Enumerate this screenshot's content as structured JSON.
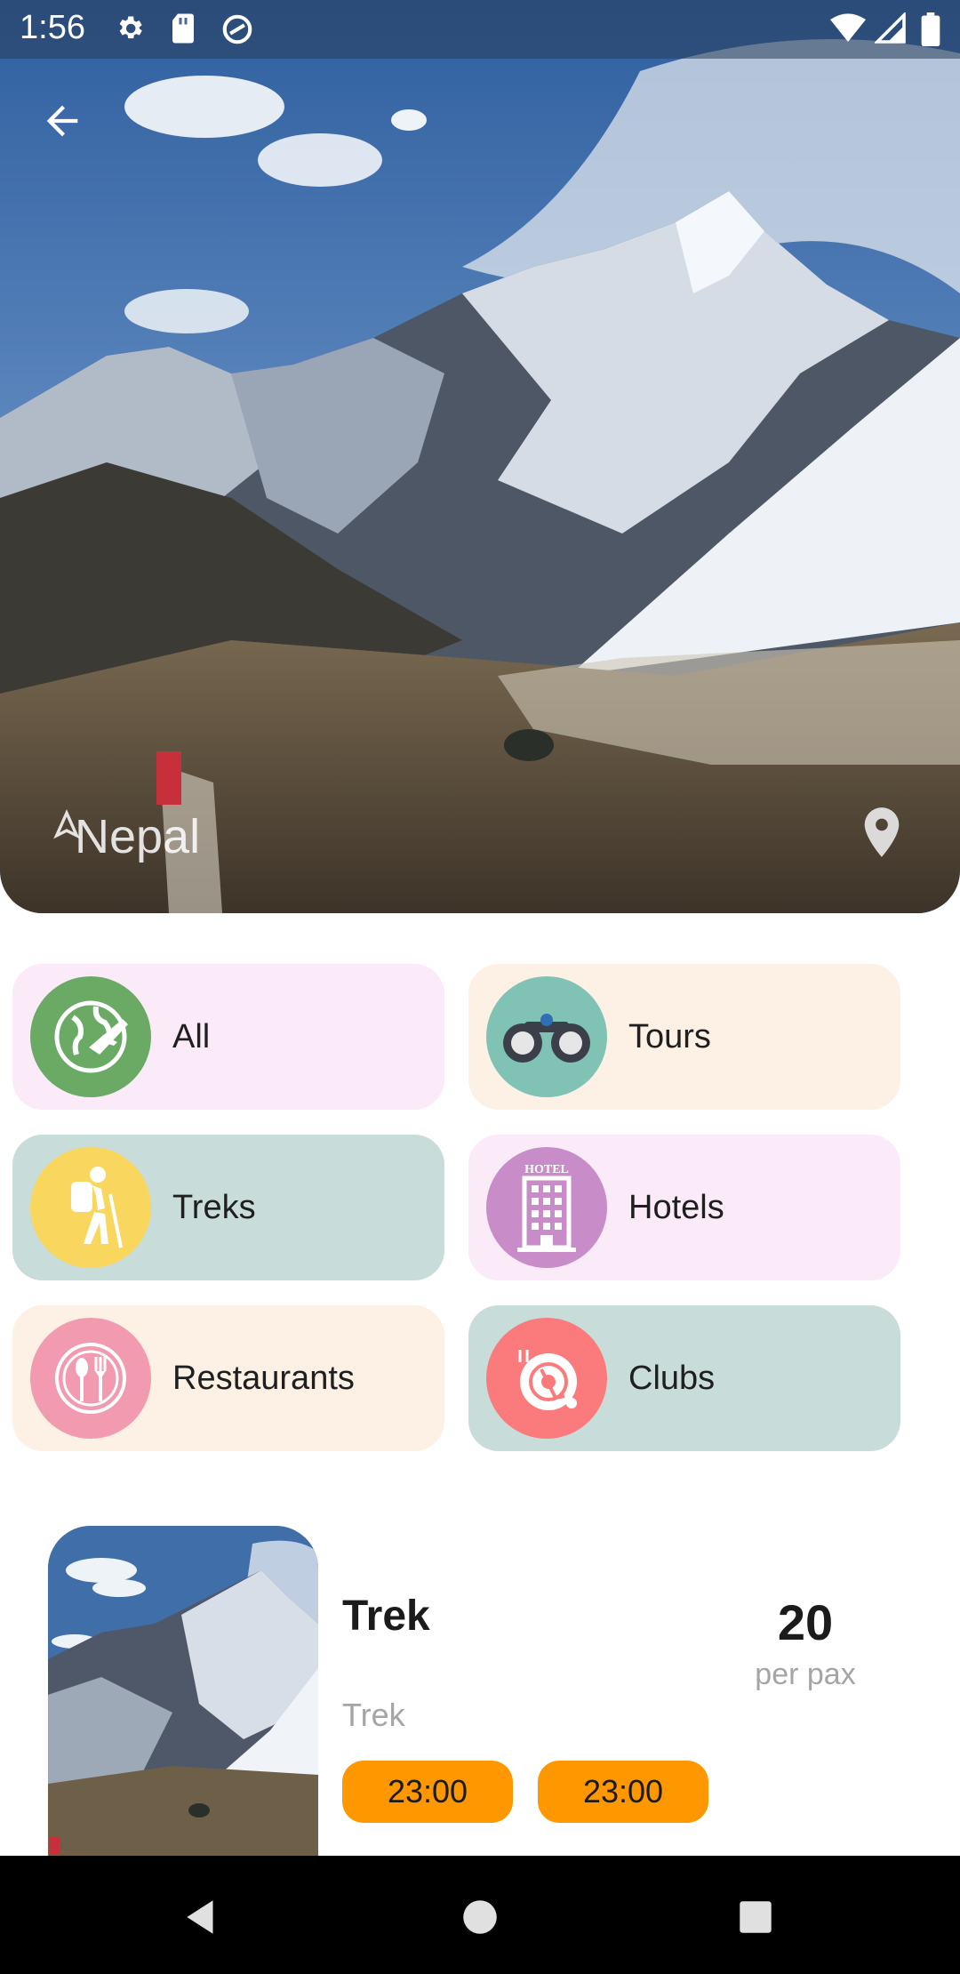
{
  "status_bar": {
    "time": "1:56"
  },
  "hero": {
    "place_name": "Nepal",
    "colors": {
      "sky": "#4f79b3",
      "snow": "#e4e9f0",
      "rock": "#515a66"
    }
  },
  "categories": [
    {
      "label": "All",
      "icon": "globe-plane-icon",
      "bg": "#fbeaf8",
      "circle": "#6aaa64"
    },
    {
      "label": "Tours",
      "icon": "binoculars-icon",
      "bg": "#fdf0e4",
      "circle": "#80c3b5"
    },
    {
      "label": "Treks",
      "icon": "hiker-icon",
      "bg": "#c8ddd9",
      "circle": "#f9d65d"
    },
    {
      "label": "Hotels",
      "icon": "hotel-building-icon",
      "bg": "#fbeaf8",
      "circle": "#c88cc9"
    },
    {
      "label": "Restaurants",
      "icon": "plate-cutlery-icon",
      "bg": "#fdf0e4",
      "circle": "#f19ab0"
    },
    {
      "label": "Clubs",
      "icon": "dj-turntable-icon",
      "bg": "#c8ddd9",
      "circle": "#fb7b7c"
    }
  ],
  "listing": {
    "title": "Trek",
    "subtitle": "Trek",
    "price": "20",
    "price_unit": "per pax",
    "times": [
      "23:00",
      "23:00"
    ],
    "chip_color": "#ff9800"
  }
}
